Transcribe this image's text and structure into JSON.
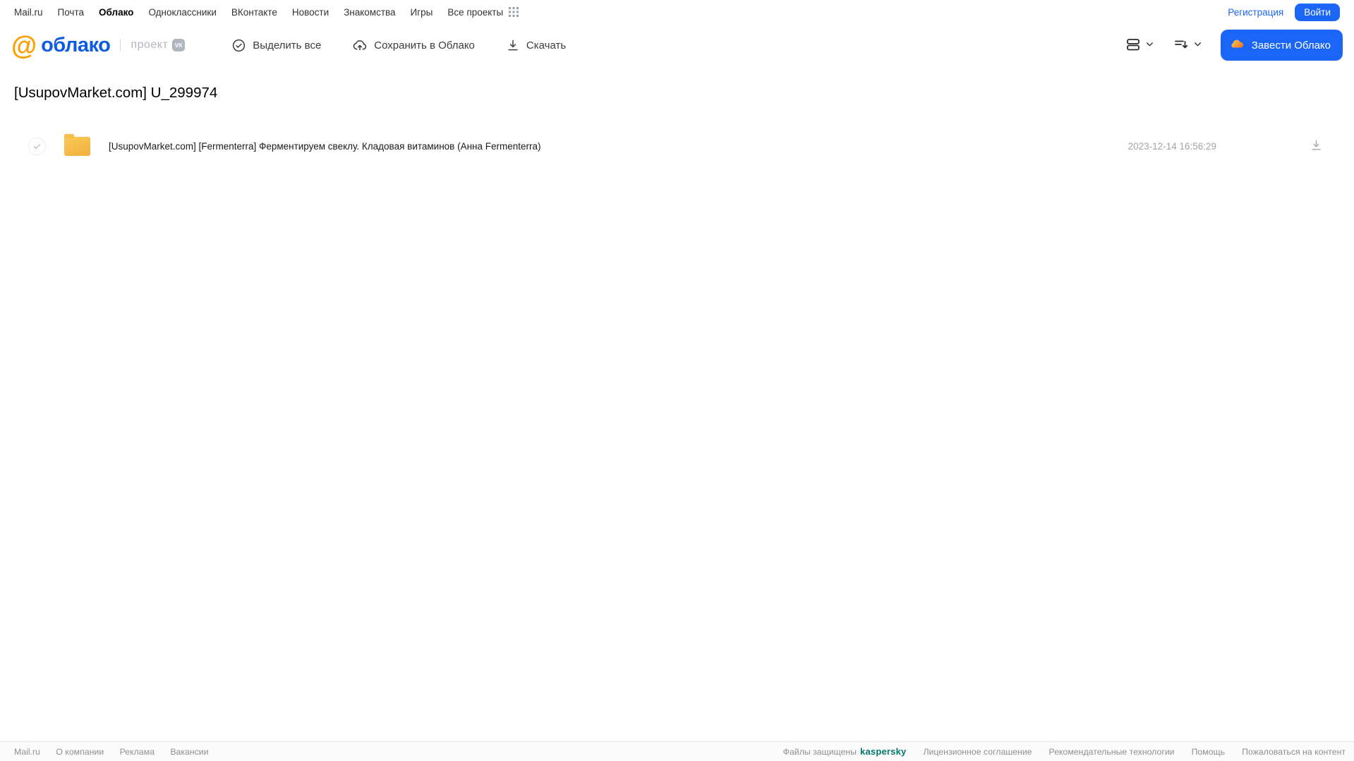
{
  "portal_nav": {
    "items": [
      "Mail.ru",
      "Почта",
      "Облако",
      "Одноклассники",
      "ВКонтакте",
      "Новости",
      "Знакомства",
      "Игры",
      "Все проекты"
    ],
    "active_item": "Облако",
    "registration_label": "Регистрация",
    "login_label": "Войти"
  },
  "header": {
    "logo_mark": "@",
    "logo_text": "облако",
    "project_label": "проект",
    "vk_badge": "VK",
    "toolbar": {
      "select_all_label": "Выделить все",
      "save_to_cloud_label": "Сохранить в Облако",
      "download_label": "Скачать"
    },
    "get_cloud_label": "Завести Облако"
  },
  "main": {
    "title": "[UsupovMarket.com] U_299974",
    "files": [
      {
        "name": "[UsupovMarket.com] [Fermenterra] Ферментируем свеклу. Кладовая витаминов (Анна Fermenterra)",
        "date": "2023-12-14 16:56:29"
      }
    ]
  },
  "footer": {
    "left_links": [
      "Mail.ru",
      "О компании",
      "Реклама",
      "Вакансии"
    ],
    "protected_label": "Файлы защищены",
    "kaspersky_label": "kaspersky",
    "right_links": [
      "Лицензионное соглашение",
      "Рекомендательные технологии",
      "Помощь",
      "Пожаловаться на контент"
    ]
  },
  "colors": {
    "accent_blue": "#1b66f9",
    "logo_orange": "#ff9e00",
    "logo_blue": "#0d5be0",
    "kaspersky_green": "#00796b",
    "folder_yellow": "#f6bf4a"
  }
}
